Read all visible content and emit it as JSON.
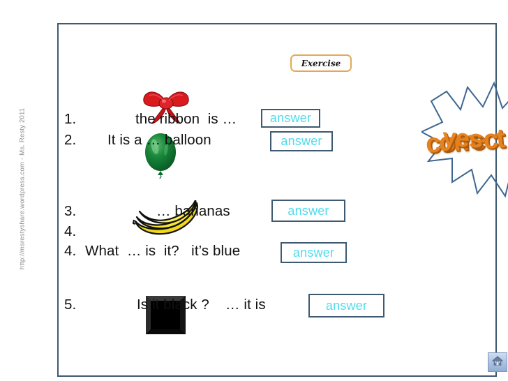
{
  "slide": {
    "title": "Exercise",
    "credit": "http://msrestyshare.wordpress.com -  Ms. Resty 2011"
  },
  "questions": [
    {
      "number": "1.",
      "text": "the ribbon  is …",
      "image": "red-ribbon-bow",
      "answer_label": "answer"
    },
    {
      "number": "2.",
      "text": "It is a … balloon",
      "image": "green-balloon",
      "answer_label": "answer"
    },
    {
      "number": "3.",
      "text": "… bananas",
      "image": "yellow-bananas",
      "answer_label": "answer"
    },
    {
      "number": "4.",
      "text": "",
      "image": "",
      "answer_label": ""
    },
    {
      "number": "4.",
      "text": "What  … is  it?   it’s blue",
      "image": "",
      "answer_label": "answer"
    },
    {
      "number": "5.",
      "text": "Is it black ?    … it is",
      "image": "black-square",
      "answer_label": "answer"
    }
  ],
  "starburst": {
    "word_top": "correct",
    "word_bottom": "yes",
    "outline_color": "#3d6690",
    "text_color": "#e5821f"
  },
  "nav": {
    "home_label": "home-icon",
    "back_label": "back-icon"
  },
  "colors": {
    "frame_border": "#3d5a70",
    "answer_text": "#4fdcec",
    "title_border": "#e3a857"
  }
}
